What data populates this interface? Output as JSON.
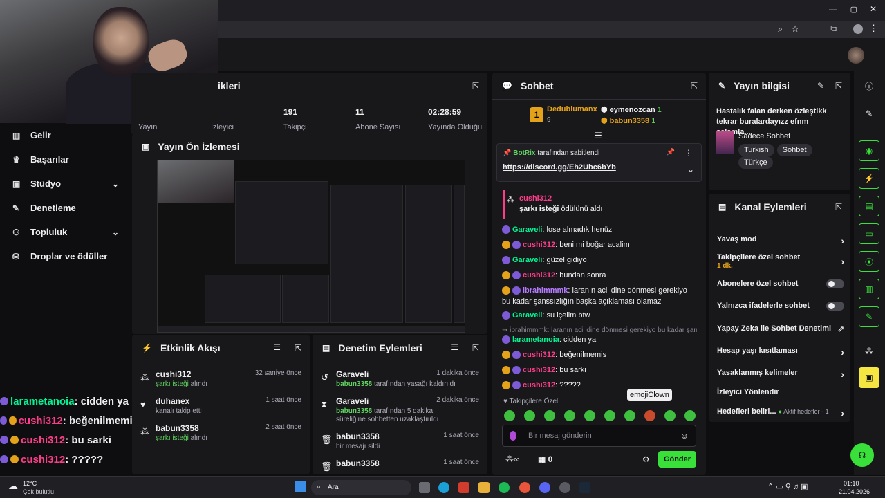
{
  "overlay_chat": [
    {
      "user": "larametanoia",
      "msg": " : cidden ya",
      "color": "#00f593",
      "badges": [
        "purple"
      ]
    },
    {
      "user": "cushi312",
      "msg": " : beğenilmemis",
      "color": "#ff3c8a",
      "badges": [
        "purple",
        "gold"
      ]
    },
    {
      "user": "cushi312",
      "msg": " : bu sarki",
      "color": "#ff3c8a",
      "badges": [
        "purple",
        "gold"
      ]
    },
    {
      "user": "cushi312",
      "msg": " : ?????",
      "color": "#ff3c8a",
      "badges": [
        "purple",
        "gold"
      ]
    }
  ],
  "sidebar": {
    "items": [
      {
        "label": "Gelir",
        "icon": "revenue-icon"
      },
      {
        "label": "Başarılar",
        "icon": "trophy-icon"
      },
      {
        "label": "Stüdyo",
        "icon": "studio-icon",
        "chevron": true
      },
      {
        "label": "Denetleme",
        "icon": "wrench-icon"
      },
      {
        "label": "Topluluk",
        "icon": "community-icon",
        "chevron": true
      },
      {
        "label": "Droplar ve ödüller",
        "icon": "drops-icon"
      }
    ]
  },
  "stats_panel": {
    "title_partial": "ikleri",
    "labels": [
      "Yayın",
      "İzleyici",
      "Takipçi",
      "Abone Sayısı",
      "Yayında Olduğu"
    ],
    "values": [
      "191",
      "11",
      "02:28:59"
    ]
  },
  "preview": {
    "title": "Yayın Ön İzlemesi"
  },
  "activity": {
    "title": "Etkinlik Akışı",
    "rows": [
      {
        "name": "cushi312",
        "sub": "şarkı isteği",
        "sub2": " alındı",
        "time": "32 saniye önce",
        "icon": "points-icon"
      },
      {
        "name": "duhanex",
        "sub": "",
        "sub2": "kanalı takip etti",
        "time": "1 saat önce",
        "icon": "heart-icon"
      },
      {
        "name": "babun3358",
        "sub": "şarkı isteği",
        "sub2": " alındı",
        "time": "2 saat önce",
        "icon": "points-icon"
      }
    ]
  },
  "moderation": {
    "title": "Denetim Eylemleri",
    "rows": [
      {
        "name": "Garaveli",
        "sub_user": "babun3358",
        "sub": " tarafından yasağı kaldırıldı",
        "time": "1 dakika önce",
        "icon": "undo-icon"
      },
      {
        "name": "Garaveli",
        "sub_user": "babun3358",
        "sub": " tarafından 5 dakika süreliğine sohbetten uzaklaştırıldı",
        "time": "2 dakika önce",
        "icon": "hourglass-icon"
      },
      {
        "name": "babun3358",
        "sub_user": "",
        "sub": "bir mesajı sildi",
        "time": "1 saat önce",
        "icon": "trash-icon"
      },
      {
        "name": "babun3358",
        "sub_user": "",
        "sub": "",
        "time": "1 saat önce",
        "icon": "trash-icon"
      }
    ]
  },
  "chat": {
    "title": "Sohbet",
    "leaders": [
      {
        "name": "Dedublumanx",
        "count": "9"
      },
      {
        "name": "eymenozcan",
        "count": "1"
      },
      {
        "name": "babun3358",
        "count": "1"
      }
    ],
    "pinned_by": "BotRix",
    "pinned_text": " tarafından sabitlendi",
    "pinned_link": "https://discord.gg/Eh2Ubc6bYb",
    "redeem_user": "cushi312",
    "redeem_text": "şarkı isteği",
    "redeem_suffix": " ödülünü aldı",
    "messages": [
      {
        "user": "Garaveli",
        "msg": ": lose almadık henüz",
        "color": "#00f593"
      },
      {
        "user": "cushi312",
        "msg": ": beni mi boğar acalim",
        "color": "#ff3c8a"
      },
      {
        "user": "Garaveli",
        "msg": ": güzel gidiyo",
        "color": "#00f593"
      },
      {
        "user": "cushi312",
        "msg": ": bundan sonra",
        "color": "#ff3c8a"
      },
      {
        "user": "ibrahimmmk",
        "msg": ": laranın acil dine dönmesi gerekiyo bu kadar şanssızlığın başka açıklaması olamaz",
        "color": "#b57bff"
      },
      {
        "user": "Garaveli",
        "msg": ": su içelim btw",
        "color": "#00f593"
      }
    ],
    "reply_ref": "ibrahimmmk: laranın acil dine dönmesi gerekiyo bu kadar şan...",
    "messages2": [
      {
        "user": "larametanoia",
        "msg": ": cidden ya",
        "color": "#00f593"
      },
      {
        "user": "cushi312",
        "msg": ": beğenilmemis",
        "color": "#ff3c8a"
      },
      {
        "user": "cushi312",
        "msg": ": bu sarki",
        "color": "#ff3c8a"
      },
      {
        "user": "cushi312",
        "msg": ": ?????",
        "color": "#ff3c8a"
      }
    ],
    "followers_only": "Takipçilere Özel",
    "tooltip": "emojiClown",
    "placeholder": "Bir mesaj gönderin",
    "points": "0",
    "send": "Gönder"
  },
  "stream_info": {
    "title": "Yayın bilgisi",
    "stream_title": "Hastalık falan derken özleştikk tekrar buralardayızz efnm selamla...",
    "category": "Sadece Sohbet",
    "tags": [
      "Turkish",
      "Sohbet",
      "Türkçe"
    ]
  },
  "channel_actions": {
    "title": "Kanal Eylemleri",
    "rows": [
      {
        "label": "Yavaş mod",
        "kind": "arrow"
      },
      {
        "label": "Takipçilere özel sohbet",
        "sub": "1 dk.",
        "kind": "arrow"
      },
      {
        "label": "Abonelere özel sohbet",
        "kind": "toggle"
      },
      {
        "label": "Yalnızca ifadelerle sohbet",
        "kind": "toggle"
      },
      {
        "label": "Yapay Zeka ile Sohbet Denetimi",
        "kind": "ext"
      },
      {
        "label": "Hesap yaşı kısıtlaması",
        "kind": "arrow"
      },
      {
        "label": "Yasaklanmış kelimeler",
        "kind": "arrow"
      },
      {
        "label": "İzleyici Yönlendir",
        "kind": "none"
      },
      {
        "label": "Hedefleri belirl...",
        "extra": "Aktif hedefler - 1",
        "kind": "arrow"
      }
    ]
  },
  "taskbar": {
    "weather_temp": "12°C",
    "weather_desc": "Çok bulutlu",
    "search": "Ara",
    "time": "01:10",
    "date": "21.04.2026"
  }
}
